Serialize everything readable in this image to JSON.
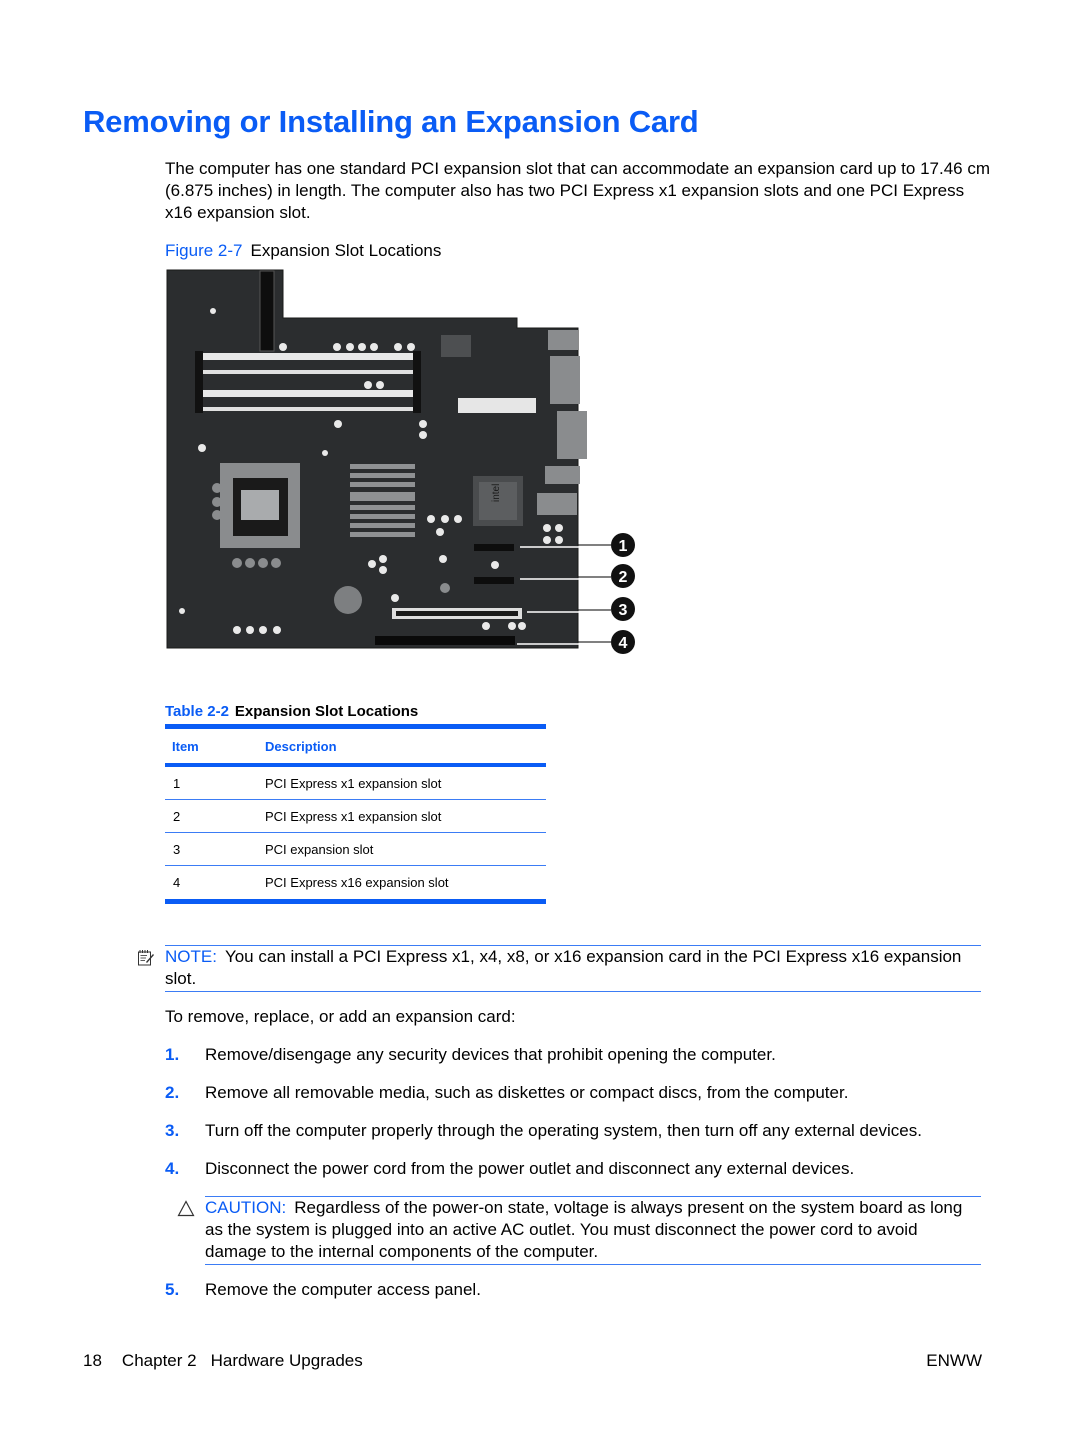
{
  "page": {
    "title": "Removing or Installing an Expansion Card",
    "intro": "The computer has one standard PCI expansion slot that can accommodate an expansion card up to 17.46 cm (6.875 inches) in length. The computer also has two PCI Express x1 expansion slots and one PCI Express x16 expansion slot."
  },
  "figure": {
    "label": "Figure 2-7",
    "caption": "Expansion Slot Locations",
    "callouts": [
      "1",
      "2",
      "3",
      "4"
    ],
    "chip_text": "intel"
  },
  "table": {
    "label": "Table 2-2",
    "caption": "Expansion Slot Locations",
    "headers": [
      "Item",
      "Description"
    ],
    "rows": [
      {
        "item": "1",
        "description": "PCI Express x1 expansion slot"
      },
      {
        "item": "2",
        "description": "PCI Express x1 expansion slot"
      },
      {
        "item": "3",
        "description": "PCI expansion slot"
      },
      {
        "item": "4",
        "description": "PCI Express x16 expansion slot"
      }
    ]
  },
  "note": {
    "label": "NOTE:",
    "text": "You can install a PCI Express x1, x4, x8, or x16 expansion card in the PCI Express x16 expansion slot.",
    "icon": "note-icon"
  },
  "procedure": {
    "intro": "To remove, replace, or add an expansion card:",
    "steps": [
      {
        "num": "1.",
        "text": "Remove/disengage any security devices that prohibit opening the computer."
      },
      {
        "num": "2.",
        "text": "Remove all removable media, such as diskettes or compact discs, from the computer."
      },
      {
        "num": "3.",
        "text": "Turn off the computer properly through the operating system, then turn off any external devices."
      },
      {
        "num": "4.",
        "text": "Disconnect the power cord from the power outlet and disconnect any external devices."
      },
      {
        "num": "5.",
        "text": "Remove the computer access panel."
      }
    ]
  },
  "caution": {
    "label": "CAUTION:",
    "text": "Regardless of the power-on state, voltage is always present on the system board as long as the system is plugged into an active AC outlet. You must disconnect the power cord to avoid damage to the internal components of the computer.",
    "icon": "caution-triangle-icon"
  },
  "footer": {
    "page_number": "18",
    "chapter": "Chapter 2",
    "chapter_title": "Hardware Upgrades",
    "right": "ENWW"
  },
  "colors": {
    "accent": "#0a5cf5",
    "board": "#2b2d2f"
  }
}
